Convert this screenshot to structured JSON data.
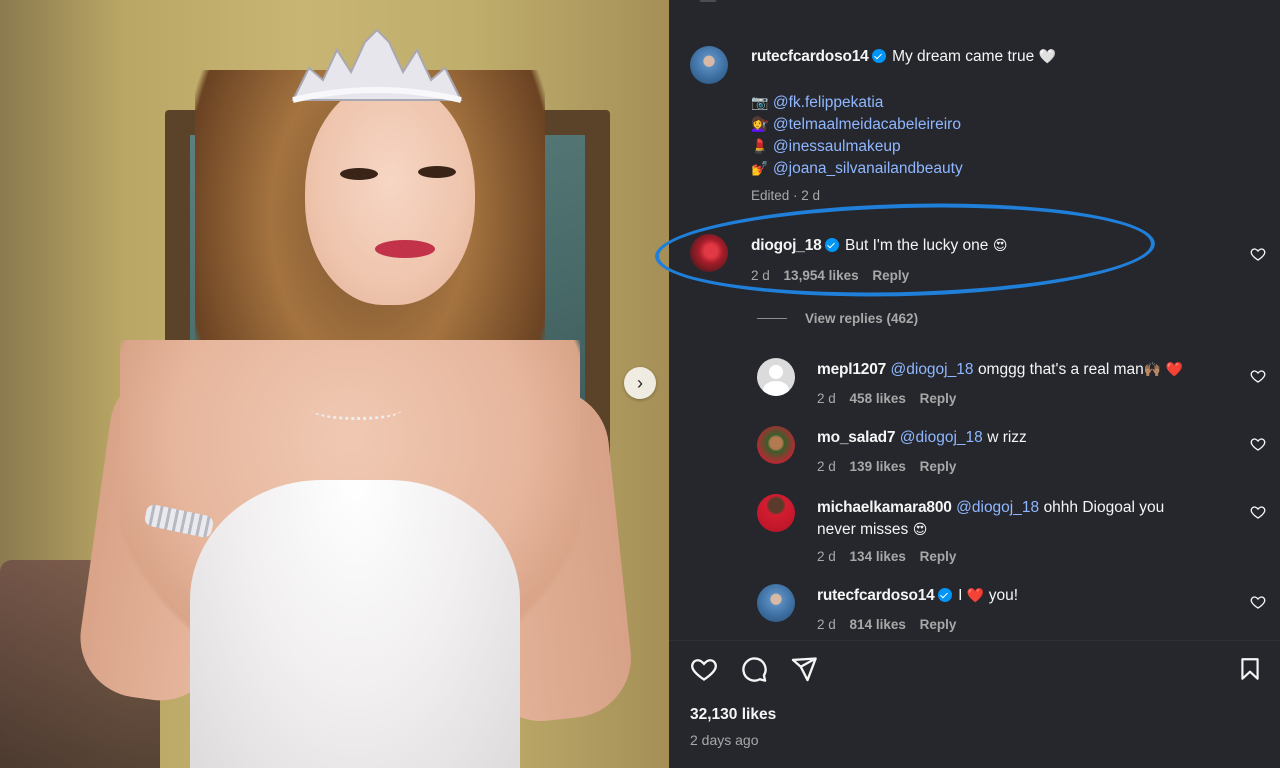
{
  "post": {
    "author": "rutecfcardoso14",
    "caption": "My dream came true",
    "caption_emoji": "🤍",
    "credits": [
      {
        "emoji": "📷",
        "handle": "@fk.felippekatia"
      },
      {
        "emoji": "💇‍♀️",
        "handle": "@telmaalmeidacabeleireiro"
      },
      {
        "emoji": "💄",
        "handle": "@inessaulmakeup"
      },
      {
        "emoji": "💅",
        "handle": "@joana_silvanailandbeauty"
      }
    ],
    "edited": "Edited · 2 d"
  },
  "comments": [
    {
      "user": "diogoj_18",
      "verified": true,
      "text": "But I'm the lucky one",
      "emoji": "😍",
      "age": "2 d",
      "likes": "13,954 likes",
      "reply": "Reply"
    }
  ],
  "view_replies": "View replies (462)",
  "replies": [
    {
      "user": "mepl1207",
      "mention": "@diogoj_18",
      "text": "omggg that's a real man",
      "emoji": "🙌🏽 ❤️",
      "age": "2 d",
      "likes": "458 likes",
      "reply": "Reply"
    },
    {
      "user": "mo_salad7",
      "mention": "@diogoj_18",
      "text": "w rizz",
      "emoji": "",
      "age": "2 d",
      "likes": "139 likes",
      "reply": "Reply"
    },
    {
      "user": "michaelkamara800",
      "mention": "@diogoj_18",
      "text": "ohhh Diogoal you",
      "text2": "never misses",
      "emoji": "😍",
      "age": "2 d",
      "likes": "134 likes",
      "reply": "Reply"
    },
    {
      "user": "rutecfcardoso14",
      "verified": true,
      "text": "I",
      "emoji": "❤️",
      "text_after": "you!",
      "age": "2 d",
      "likes": "814 likes",
      "reply": "Reply"
    }
  ],
  "footer": {
    "likes": "32,130 likes",
    "ago": "2 days ago"
  },
  "icons": {
    "next": "chevron-right-icon",
    "like": "heart-icon",
    "comment": "comment-icon",
    "share": "paper-plane-icon",
    "save": "bookmark-icon"
  },
  "colors": {
    "panel_bg": "#25272d",
    "link": "#8fb7ff",
    "highlight": "#1f7fd9",
    "verified": "#0095f6"
  }
}
